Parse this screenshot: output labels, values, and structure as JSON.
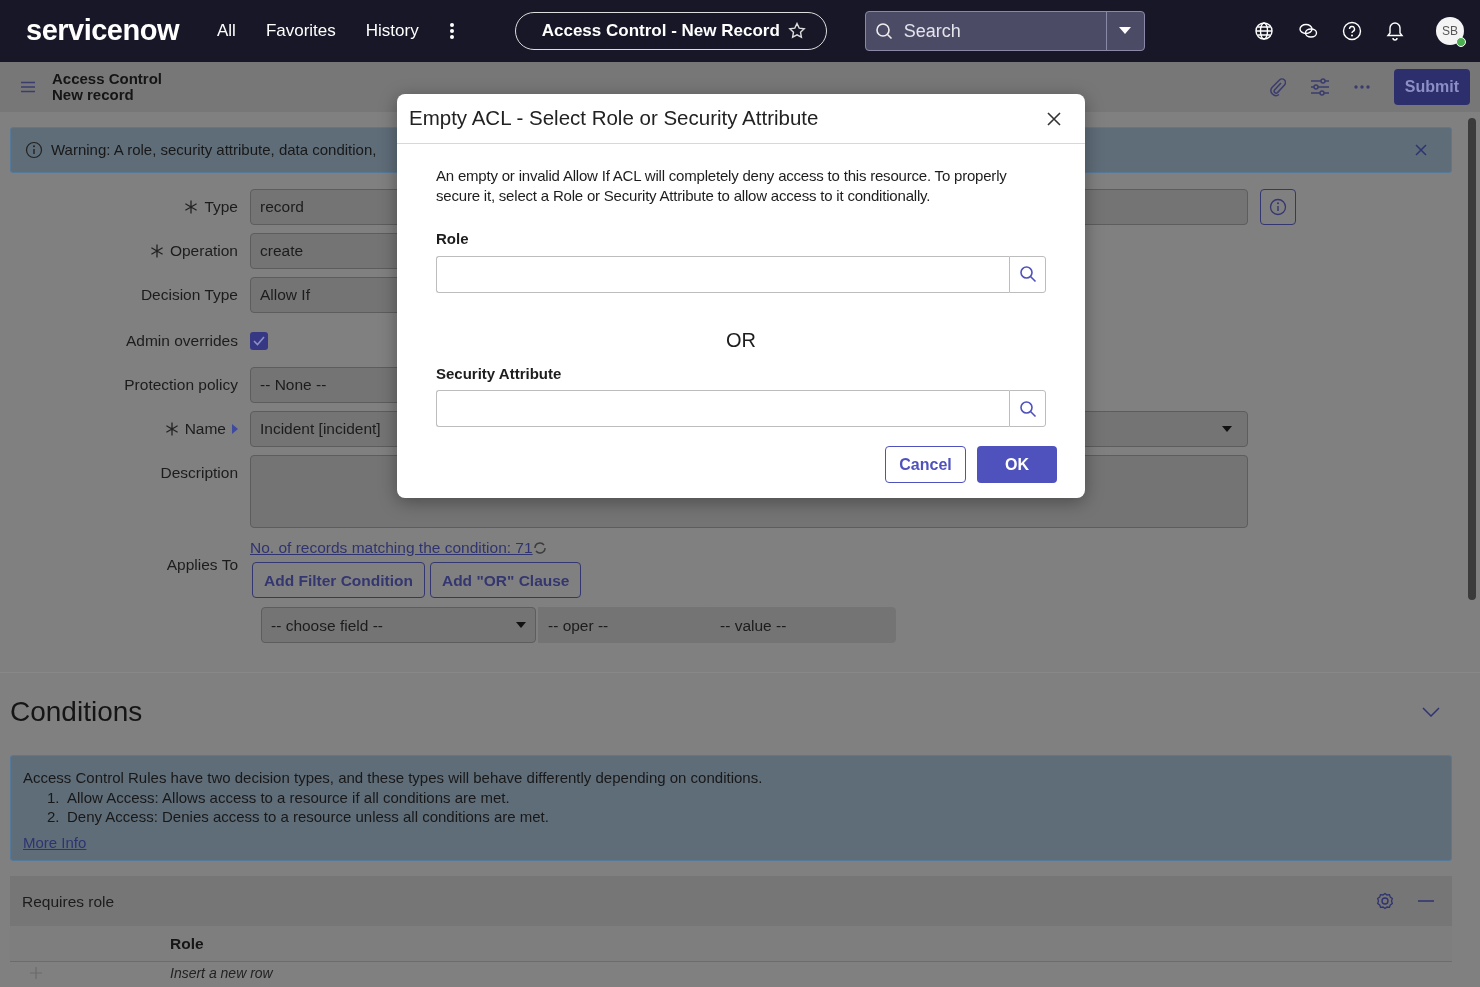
{
  "header": {
    "logo": "servicenow",
    "nav": [
      "All",
      "Favorites",
      "History"
    ],
    "record_tab": "Access Control - New Record",
    "search": {
      "placeholder": "Search"
    },
    "avatar": "SB",
    "avatar_online": true
  },
  "subheader": {
    "title": "Access Control",
    "subtitle": "New record",
    "submit": "Submit"
  },
  "warning": {
    "text": "Warning: A role, security attribute, data condition,"
  },
  "form": {
    "fields": [
      {
        "kind": "lookup",
        "label": "Type",
        "required": true,
        "value": "record"
      },
      {
        "kind": "select",
        "label": "Operation",
        "required": true,
        "value": "create"
      },
      {
        "kind": "select",
        "label": "Decision Type",
        "required": false,
        "value": "Allow If"
      },
      {
        "kind": "checkbox",
        "label": "Admin overrides",
        "required": false,
        "checked": true
      },
      {
        "kind": "select",
        "label": "Protection policy",
        "required": false,
        "value": "-- None --"
      },
      {
        "kind": "reference",
        "label": "Name",
        "required": true,
        "value": "Incident [incident]"
      },
      {
        "kind": "textarea",
        "label": "Description",
        "required": false
      }
    ]
  },
  "applies_to": {
    "label": "Applies To",
    "count_link": "No. of records matching the condition: 71",
    "buttons": [
      "Add Filter Condition",
      "Add \"OR\" Clause"
    ],
    "filter": {
      "field": "-- choose field --",
      "oper": "-- oper --",
      "value": "-- value --"
    }
  },
  "conditions": {
    "title": "Conditions",
    "expanded": true,
    "info": {
      "intro": "Access Control Rules have two decision types, and these types will behave differently depending on conditions.",
      "items": [
        {
          "number": "1.",
          "text": "Allow Access: Allows access to a resource if all conditions are met."
        },
        {
          "number": "2.",
          "text": "Deny Access: Denies access to a resource unless all conditions are met."
        }
      ],
      "link": "More Info"
    },
    "panel": {
      "title": "Requires role",
      "columns": [
        "Role"
      ],
      "insert_row": "Insert a new row"
    }
  },
  "dialog": {
    "title": "Empty ACL - Select Role or Security Attribute",
    "message": "An empty or invalid Allow If ACL will completely deny access to this resource. To properly secure it, select a Role or Security Attribute to allow access to it conditionally.",
    "fields": [
      {
        "label": "Role"
      },
      {
        "label": "Security Attribute"
      }
    ],
    "separator": "OR",
    "buttons": [
      {
        "kind": "secondary",
        "label": "Cancel"
      },
      {
        "kind": "primary",
        "label": "OK"
      }
    ]
  }
}
